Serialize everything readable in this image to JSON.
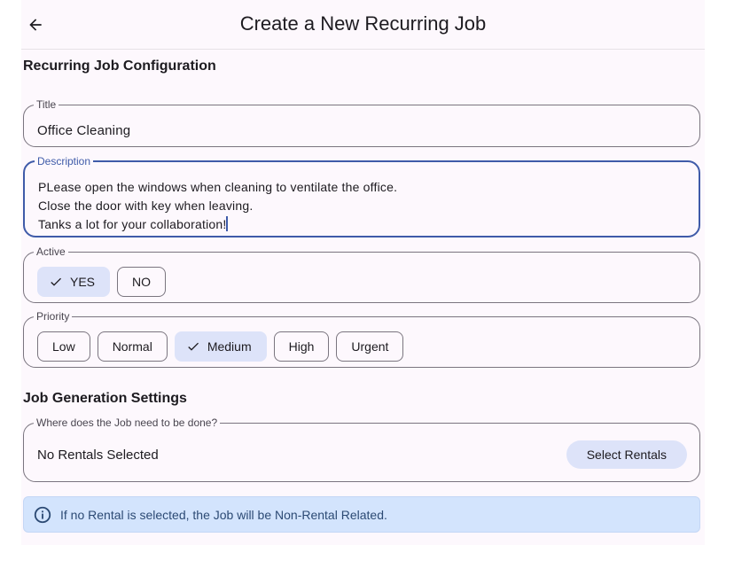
{
  "appbar": {
    "title": "Create a New Recurring Job",
    "back_icon": "arrow-left-icon"
  },
  "config_section": {
    "title": "Recurring Job Configuration",
    "title_field": {
      "label": "Title",
      "value": "Office Cleaning"
    },
    "description_field": {
      "label": "Description",
      "lines": [
        "PLease open the windows when cleaning to ventilate the office.",
        "Close the door with key when leaving.",
        "Tanks a lot for your collaboration!"
      ]
    },
    "active": {
      "label": "Active",
      "options": [
        {
          "label": "YES",
          "selected": true
        },
        {
          "label": "NO",
          "selected": false
        }
      ]
    },
    "priority": {
      "label": "Priority",
      "options": [
        {
          "label": "Low",
          "selected": false
        },
        {
          "label": "Normal",
          "selected": false
        },
        {
          "label": "Medium",
          "selected": true
        },
        {
          "label": "High",
          "selected": false
        },
        {
          "label": "Urgent",
          "selected": false
        }
      ]
    }
  },
  "generation_section": {
    "title": "Job Generation Settings",
    "location": {
      "label": "Where does the Job need to be done?",
      "value": "No Rentals Selected",
      "button_label": "Select Rentals"
    },
    "info": {
      "icon": "info-icon",
      "text": "If no Rental is selected, the Job will be Non-Rental Related."
    }
  },
  "colors": {
    "accent": "#3f5ba9",
    "chip_selected": "#dde3f9",
    "info_background": "#d3e4fd"
  }
}
